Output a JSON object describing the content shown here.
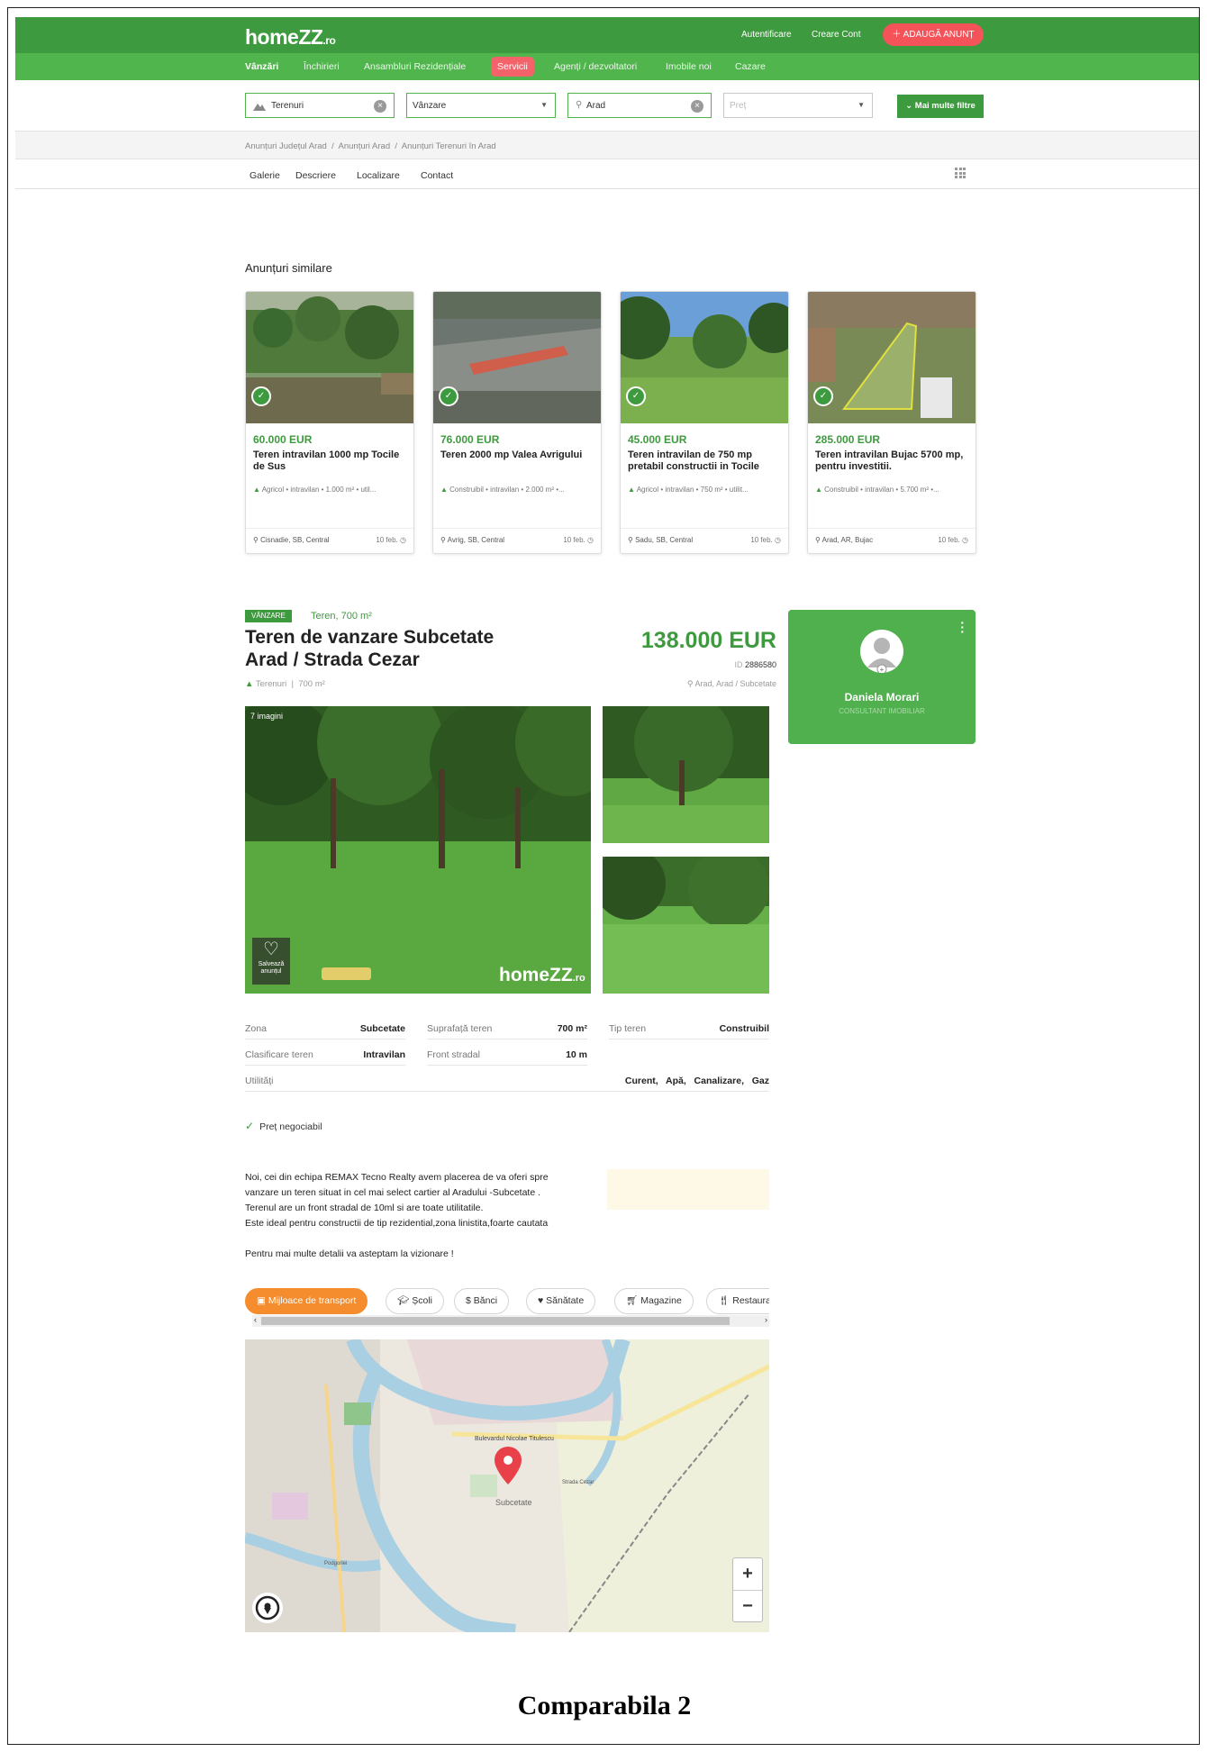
{
  "header": {
    "logo": "homeZZ",
    "logo_tld": ".ro",
    "login": "Autentificare",
    "create_account": "Creare Cont",
    "add_listing": "ADAUGĂ ANUNȚ"
  },
  "nav": {
    "items": [
      "Vânzări",
      "Închirieri",
      "Ansambluri Rezidențiale",
      "Servicii",
      "Agenți / dezvoltatori",
      "Imobile noi",
      "Cazare"
    ]
  },
  "search": {
    "type_value": "Terenuri",
    "transaction_value": "Vânzare",
    "location_value": "Arad",
    "price_placeholder": "Preț",
    "more_filters": "Mai multe filtre"
  },
  "breadcrumb": {
    "items": [
      "Anunțuri Județul Arad",
      "Anunțuri Arad",
      "Anunțuri Terenuri în Arad"
    ],
    "separator": "/"
  },
  "tabs": [
    "Galerie",
    "Descriere",
    "Localizare",
    "Contact"
  ],
  "similar": {
    "title": "Anunțuri similare",
    "cards": [
      {
        "price": "60.000 EUR",
        "title": "Teren intravilan 1000 mp Tocile de Sus",
        "meta": "Agricol • intravilan • 1.000 m² • util...",
        "location": "Cisnadie, SB, Central",
        "date": "10 feb."
      },
      {
        "price": "76.000 EUR",
        "title": "Teren 2000 mp Valea Avrigului",
        "meta": "Construibil • intravilan • 2.000 m² •...",
        "location": "Avrig, SB, Central",
        "date": "10 feb."
      },
      {
        "price": "45.000 EUR",
        "title": "Teren intravilan de 750 mp pretabil constructii in Tocile",
        "meta": "Agricol • intravilan • 750 m² • utilit...",
        "location": "Sadu, SB, Central",
        "date": "10 feb."
      },
      {
        "price": "285.000 EUR",
        "title": "Teren intravilan Bujac 5700 mp, pentru investitii.",
        "meta": "Construibil • intravilan • 5.700 m² •...",
        "location": "Arad, AR, Bujac",
        "date": "10 feb."
      }
    ]
  },
  "listing": {
    "tag": "VÂNZARE",
    "subtype": "Teren, 700 m²",
    "title": "Teren de vanzare Subcetate Arad / Strada Cezar",
    "meta_type": "Terenuri",
    "meta_area": "700 m²",
    "price": "138.000 EUR",
    "id_label": "ID",
    "id_value": "2886580",
    "location": "Arad, Arad / Subcetate",
    "image_count": "7 imagini",
    "save_label": "Salvează anunțul",
    "watermark": "homeZZ",
    "watermark_tld": ".ro"
  },
  "agent": {
    "name": "Daniela Morari",
    "role": "CONSULTANT IMOBILIAR"
  },
  "specs": {
    "zona_k": "Zona",
    "zona_v": "Subcetate",
    "supr_k": "Suprafață teren",
    "supr_v": "700 m²",
    "tip_k": "Tip teren",
    "tip_v": "Construibil",
    "clas_k": "Clasificare teren",
    "clas_v": "Intravilan",
    "front_k": "Front stradal",
    "front_v": "10 m",
    "util_k": "Utilități",
    "util_v": "Curent,   Apă,   Canalizare,   Gaz"
  },
  "negotiable": "Preț negociabil",
  "description": {
    "lines": [
      "Noi, cei din echipa REMAX Tecno Realty avem placerea de va oferi spre",
      "vanzare un teren situat in cel mai select cartier al Aradului -Subcetate .",
      "Terenul are un front stradal de 10ml si are toate utilitatile.",
      "Este ideal pentru constructii de tip rezidential,zona linistita,foarte cautata",
      "Pentru mai multe detalii va asteptam la vizionare !"
    ]
  },
  "poi": {
    "items": [
      "Mijloace de transport",
      "Școli",
      "Bănci",
      "Sănătate",
      "Magazine",
      "Restaurante"
    ]
  },
  "map": {
    "labels": [
      "Bulevardul Nicolae Titulescu",
      "Subcetate",
      "Strada Cezar",
      "Podgoriei"
    ],
    "zoom_in": "+",
    "zoom_out": "−"
  },
  "caption": "Comparabila 2"
}
